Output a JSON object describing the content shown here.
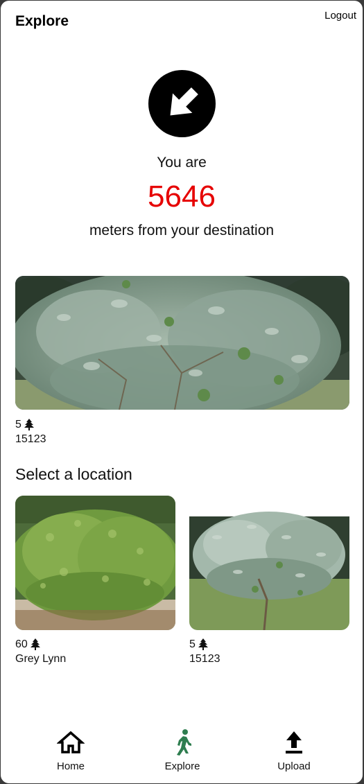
{
  "header": {
    "title": "Explore",
    "logout_label": "Logout"
  },
  "direction": {
    "icon": "arrow-down-right-icon",
    "prefix": "You are",
    "distance": "5646",
    "suffix": "meters from your destination",
    "distance_color": "#e60000"
  },
  "featured": {
    "count": "5",
    "count_icon": "tree-icon",
    "name": "15123"
  },
  "locations": {
    "heading": "Select a location",
    "items": [
      {
        "count": "60",
        "count_icon": "tree-icon",
        "name": "Grey Lynn"
      },
      {
        "count": "5",
        "count_icon": "tree-icon",
        "name": "15123"
      }
    ]
  },
  "nav": {
    "items": [
      {
        "label": "Home",
        "icon": "home-icon",
        "active": false
      },
      {
        "label": "Explore",
        "icon": "walking-person-icon",
        "active": true
      },
      {
        "label": "Upload",
        "icon": "upload-icon",
        "active": false
      }
    ],
    "active_color": "#2e7d4f"
  }
}
